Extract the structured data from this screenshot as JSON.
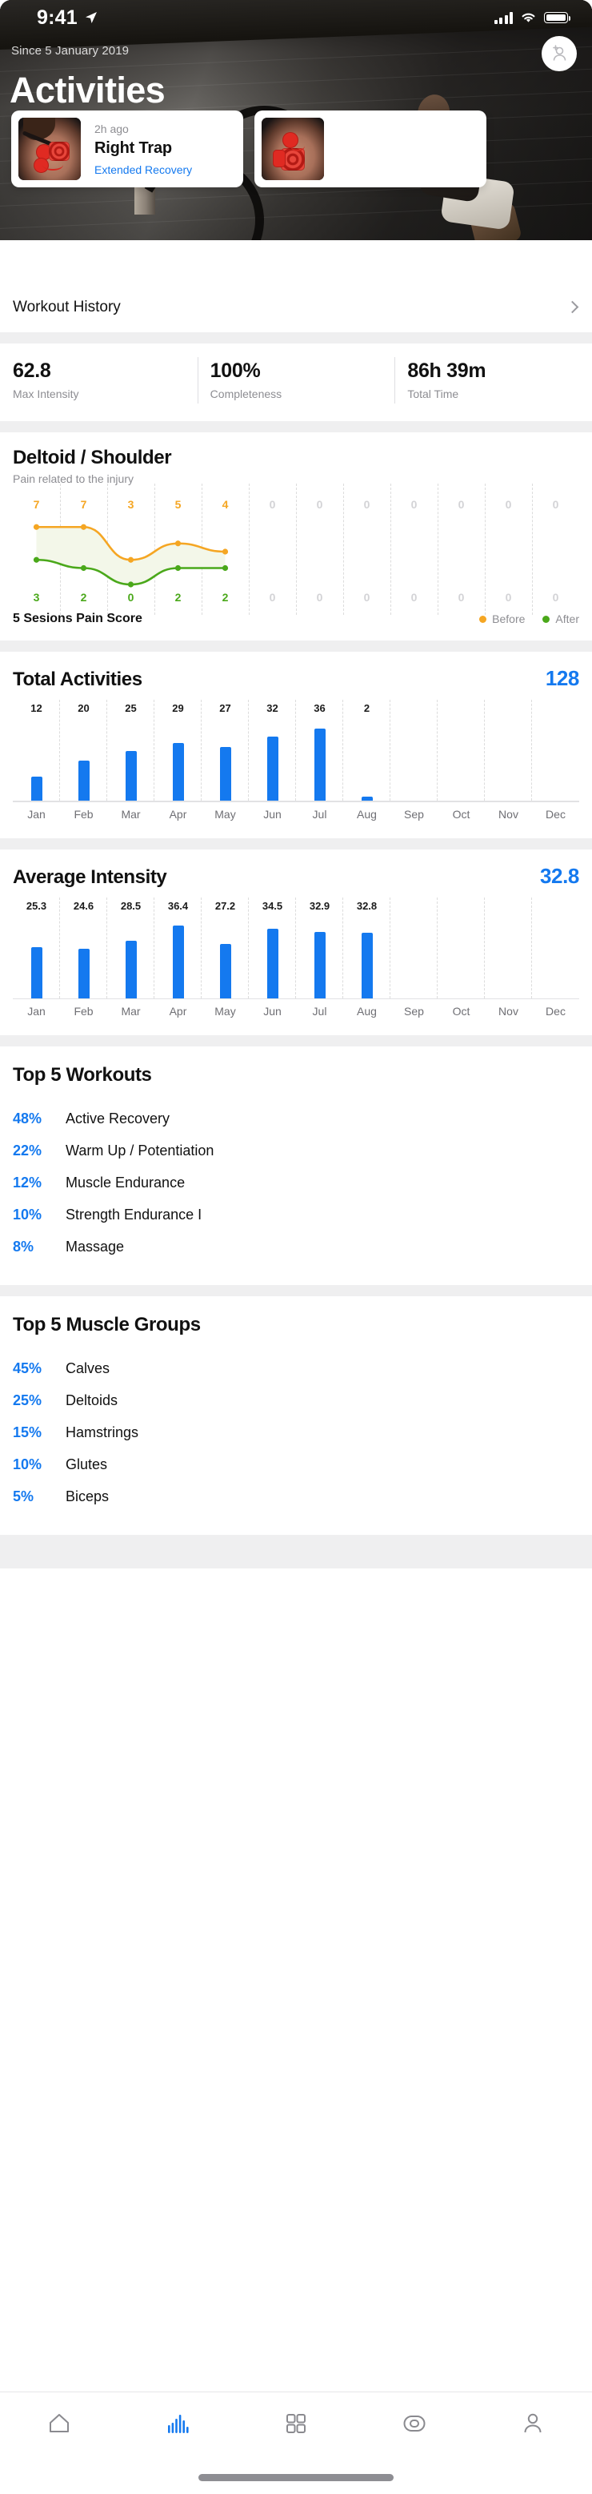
{
  "status_bar": {
    "time": "9:41",
    "location_icon": "location-arrow-icon",
    "cellular_icon": "cellular-signal-icon",
    "wifi_icon": "wifi-icon",
    "battery_icon": "battery-icon"
  },
  "hero": {
    "since": "Since 5 January 2019",
    "title": "Activities",
    "avatar_icon": "add-person-icon"
  },
  "carousel": {
    "cards": [
      {
        "time": "2h ago",
        "name": "Right Trap",
        "tag": "Extended Recovery",
        "thumb_icon": "trap-electrode-photo"
      },
      {
        "time": "",
        "name": "",
        "tag": "",
        "thumb_icon": "leg-electrode-photo"
      }
    ]
  },
  "workout_history": {
    "label": "Workout History",
    "chevron_icon": "chevron-right-icon"
  },
  "summary_stats": [
    {
      "value": "62.8",
      "label": "Max Intensity"
    },
    {
      "value": "100%",
      "label": "Completeness"
    },
    {
      "value": "86h 39m",
      "label": "Total Time"
    }
  ],
  "colors": {
    "accent_blue": "#1479ef",
    "before_orange": "#f5a623",
    "after_green": "#4aa81a",
    "zero_grey": "#d3d3d6"
  },
  "top_workouts": {
    "title": "Top 5 Workouts",
    "rows": [
      {
        "pct": "48%",
        "name": "Active Recovery"
      },
      {
        "pct": "22%",
        "name": "Warm Up / Potentiation"
      },
      {
        "pct": "12%",
        "name": "Muscle Endurance"
      },
      {
        "pct": "10%",
        "name": "Strength Endurance I"
      },
      {
        "pct": "8%",
        "name": "Massage"
      }
    ]
  },
  "top_muscle_groups": {
    "title": "Top 5 Muscle Groups",
    "rows": [
      {
        "pct": "45%",
        "name": "Calves"
      },
      {
        "pct": "25%",
        "name": "Deltoids"
      },
      {
        "pct": "15%",
        "name": "Hamstrings"
      },
      {
        "pct": "10%",
        "name": "Glutes"
      },
      {
        "pct": "5%",
        "name": "Biceps"
      }
    ]
  },
  "tab_bar": {
    "items": [
      {
        "icon": "home-icon",
        "active": false
      },
      {
        "icon": "bar-chart-icon",
        "active": true
      },
      {
        "icon": "grid-icon",
        "active": false
      },
      {
        "icon": "squircle-icon",
        "active": false
      },
      {
        "icon": "person-icon",
        "active": false
      }
    ]
  },
  "chart_data": [
    {
      "type": "line",
      "title": "Deltoid / Shoulder",
      "subtitle": "Pain related to the injury",
      "footer_label": "5 Sesions Pain Score",
      "xlabel": "",
      "ylabel": "",
      "ylim": [
        0,
        10
      ],
      "grid": true,
      "legend_position": "bottom-right",
      "x": [
        1,
        2,
        3,
        4,
        5,
        6,
        7,
        8,
        9,
        10,
        11,
        12
      ],
      "series": [
        {
          "name": "Before",
          "color": "#f5a623",
          "values": [
            7,
            7,
            3,
            5,
            4,
            0,
            0,
            0,
            0,
            0,
            0,
            0
          ]
        },
        {
          "name": "After",
          "color": "#4aa81a",
          "values": [
            3,
            2,
            0,
            2,
            2,
            0,
            0,
            0,
            0,
            0,
            0,
            0
          ]
        }
      ]
    },
    {
      "type": "bar",
      "title": "Total Activities",
      "total": "128",
      "categories": [
        "Jan",
        "Feb",
        "Mar",
        "Apr",
        "May",
        "Jun",
        "Jul",
        "Aug",
        "Sep",
        "Oct",
        "Nov",
        "Dec"
      ],
      "values": [
        12,
        20,
        25,
        29,
        27,
        32,
        36,
        2,
        null,
        null,
        null,
        null
      ],
      "value_labels": [
        "12",
        "20",
        "25",
        "29",
        "27",
        "32",
        "36",
        "2",
        "",
        "",
        "",
        ""
      ],
      "ylim": [
        0,
        40
      ],
      "grid": true,
      "ylabel": "",
      "xlabel": "",
      "bar_color": "#1479ef"
    },
    {
      "type": "bar",
      "title": "Average Intensity",
      "total": "32.8",
      "categories": [
        "Jan",
        "Feb",
        "Mar",
        "Apr",
        "May",
        "Jun",
        "Jul",
        "Aug",
        "Sep",
        "Oct",
        "Nov",
        "Dec"
      ],
      "values": [
        25.3,
        24.6,
        28.5,
        36.4,
        27.2,
        34.5,
        32.9,
        32.8,
        null,
        null,
        null,
        null
      ],
      "value_labels": [
        "25.3",
        "24.6",
        "28.5",
        "36.4",
        "27.2",
        "34.5",
        "32.9",
        "32.8",
        "",
        "",
        "",
        ""
      ],
      "ylim": [
        0,
        40
      ],
      "grid": true,
      "ylabel": "",
      "xlabel": "",
      "bar_color": "#1479ef"
    }
  ]
}
